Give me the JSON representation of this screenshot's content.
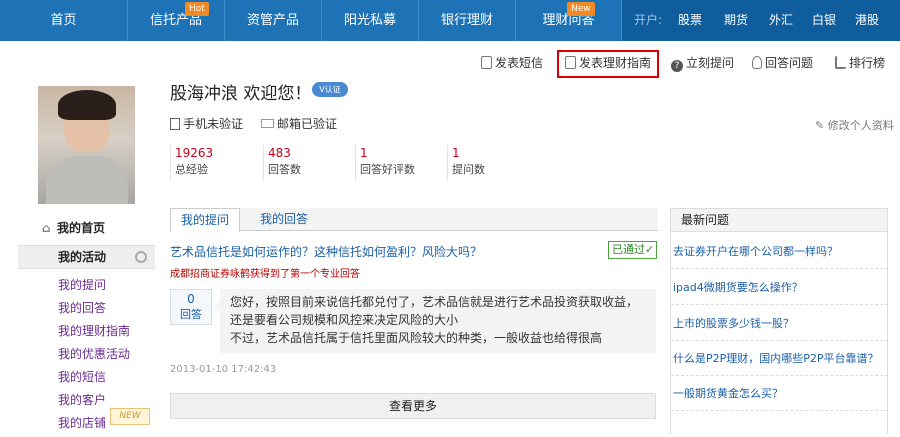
{
  "nav": {
    "items": [
      "首页",
      "信托产品",
      "资管产品",
      "阳光私募",
      "银行理财",
      "理财问答"
    ],
    "badges": {
      "hot": "Hot",
      "new": "New"
    },
    "right_label": "开户:",
    "right_items": [
      "股票",
      "期货",
      "外汇",
      "白银",
      "港股"
    ]
  },
  "toolbar": {
    "items": [
      "发表短信",
      "发表理财指南",
      "立刻提问",
      "回答问题",
      "排行榜"
    ]
  },
  "profile": {
    "title": "股海冲浪 欢迎您！",
    "v_badge": "V认证",
    "phone": "手机未验证",
    "email": "邮箱已验证",
    "edit": "修改个人资料",
    "stats": [
      {
        "value": "19263",
        "label": "总经验"
      },
      {
        "value": "483",
        "label": "回答数"
      },
      {
        "value": "1",
        "label": "回答好评数"
      },
      {
        "value": "1",
        "label": "提问数"
      }
    ]
  },
  "left": {
    "home": "我的首页",
    "activity": "我的活动",
    "menu": [
      "我的提问",
      "我的回答",
      "我的理财指南",
      "我的优惠活动",
      "我的短信",
      "我的客户",
      "我的店铺"
    ],
    "new_tag": "NEW"
  },
  "main": {
    "tabs": [
      "我的提问",
      "我的回答"
    ],
    "question": "艺术品信托是如何运作的？这种信托如何盈利？风险大吗？",
    "status": "已通过",
    "meta": "成都招商证券咏鹤获得到了第一个专业回答",
    "answer_count": "0",
    "answer_label": "回答",
    "answer_lines": [
      "您好，按照目前来说信托都兑付了，艺术品信就是进行艺术品投资获取收益，",
      "还是要看公司规模和风控来决定风险的大小",
      "不过，艺术品信托属于信托里面风险较大的种类，一般收益也给得很高"
    ],
    "date": "2013-01-10 17:42:43",
    "more": "查看更多"
  },
  "right": {
    "title": "最新问题",
    "items": [
      "去证券开户在哪个公司都一样吗？",
      "ipad4微期货要怎么操作？",
      "上市的股票多少钱一股？",
      "什么是P2P理财，国内哪些P2P平台靠谱？",
      "一般期货黄金怎么买？"
    ]
  }
}
